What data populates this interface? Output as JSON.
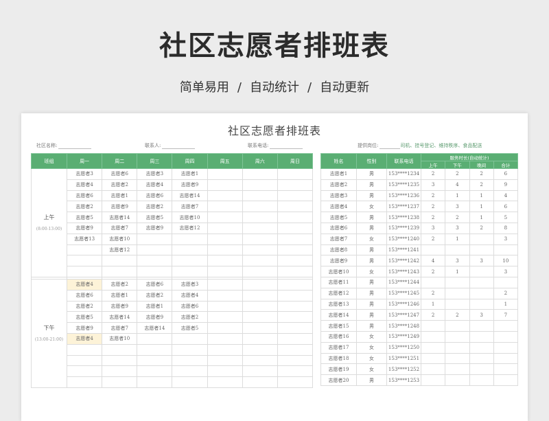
{
  "banner": {
    "title": "社区志愿者排班表",
    "sub1": "简单易用",
    "sub2": "自动统计",
    "sub3": "自动更新",
    "sep": "/"
  },
  "sheet": {
    "title": "社区志愿者排班表",
    "info": {
      "community_label": "社区名称:",
      "contact_label": "联系人:",
      "phone_label": "联系电话:",
      "post_label": "提供岗位:",
      "post_value": "司机、挂号登记、维持秩序、食品配送"
    },
    "schedule": {
      "headers": [
        "班组",
        "周一",
        "周二",
        "周三",
        "周四",
        "周五",
        "周六",
        "周日"
      ],
      "am_label": "上午",
      "am_hours": "(8:00-13:00)",
      "pm_label": "下午",
      "pm_hours": "(13:00-21:00)",
      "am_rows": [
        [
          "志愿者3",
          "志愿者6",
          "志愿者3",
          "志愿者1",
          "",
          "",
          ""
        ],
        [
          "志愿者4",
          "志愿者2",
          "志愿者4",
          "志愿者9",
          "",
          "",
          ""
        ],
        [
          "志愿者6",
          "志愿者1",
          "志愿者6",
          "志愿者14",
          "",
          "",
          ""
        ],
        [
          "志愿者2",
          "志愿者9",
          "志愿者2",
          "志愿者7",
          "",
          "",
          ""
        ],
        [
          "志愿者5",
          "志愿者14",
          "志愿者5",
          "志愿者10",
          "",
          "",
          ""
        ],
        [
          "志愿者9",
          "志愿者7",
          "志愿者9",
          "志愿者12",
          "",
          "",
          ""
        ],
        [
          "志愿者13",
          "志愿者10",
          "",
          "",
          "",
          "",
          ""
        ],
        [
          "",
          "志愿者12",
          "",
          "",
          "",
          "",
          ""
        ],
        [
          "",
          "",
          "",
          "",
          "",
          "",
          ""
        ],
        [
          "",
          "",
          "",
          "",
          "",
          "",
          ""
        ]
      ],
      "pm_rows": [
        [
          "志愿者4",
          "志愿者2",
          "志愿者6",
          "志愿者3",
          "",
          "",
          ""
        ],
        [
          "志愿者6",
          "志愿者1",
          "志愿者2",
          "志愿者4",
          "",
          "",
          ""
        ],
        [
          "志愿者2",
          "志愿者9",
          "志愿者1",
          "志愿者6",
          "",
          "",
          ""
        ],
        [
          "志愿者5",
          "志愿者14",
          "志愿者9",
          "志愿者2",
          "",
          "",
          ""
        ],
        [
          "志愿者9",
          "志愿者7",
          "志愿者14",
          "志愿者5",
          "",
          "",
          ""
        ],
        [
          "志愿者4",
          "志愿者10",
          "",
          "",
          "",
          "",
          ""
        ],
        [
          "",
          "",
          "",
          "",
          "",
          "",
          ""
        ],
        [
          "",
          "",
          "",
          "",
          "",
          "",
          ""
        ],
        [
          "",
          "",
          "",
          "",
          "",
          "",
          ""
        ],
        [
          "",
          "",
          "",
          "",
          "",
          "",
          ""
        ]
      ],
      "pm_highlight": [
        [
          0,
          0
        ],
        [
          5,
          0
        ]
      ]
    },
    "roster": {
      "headers": [
        "姓名",
        "性别",
        "联系电话",
        "服务时长(自动统计)"
      ],
      "subheaders": [
        "上午",
        "下午",
        "晚间",
        "合计"
      ],
      "rows": [
        [
          "志愿者1",
          "男",
          "153****1234",
          "2",
          "2",
          "2",
          "6"
        ],
        [
          "志愿者2",
          "男",
          "153****1235",
          "3",
          "4",
          "2",
          "9"
        ],
        [
          "志愿者3",
          "男",
          "153****1236",
          "2",
          "1",
          "1",
          "4"
        ],
        [
          "志愿者4",
          "女",
          "153****1237",
          "2",
          "3",
          "1",
          "6"
        ],
        [
          "志愿者5",
          "男",
          "153****1238",
          "2",
          "2",
          "1",
          "5"
        ],
        [
          "志愿者6",
          "男",
          "153****1239",
          "3",
          "3",
          "2",
          "8"
        ],
        [
          "志愿者7",
          "女",
          "153****1240",
          "2",
          "1",
          "",
          "3"
        ],
        [
          "志愿者8",
          "男",
          "153****1241",
          "",
          "",
          "",
          ""
        ],
        [
          "志愿者9",
          "男",
          "153****1242",
          "4",
          "3",
          "3",
          "10"
        ],
        [
          "志愿者10",
          "女",
          "153****1243",
          "2",
          "1",
          "",
          "3"
        ],
        [
          "志愿者11",
          "男",
          "153****1244",
          "",
          "",
          "",
          ""
        ],
        [
          "志愿者12",
          "男",
          "153****1245",
          "2",
          "",
          "",
          "2"
        ],
        [
          "志愿者13",
          "男",
          "153****1246",
          "1",
          "",
          "",
          "1"
        ],
        [
          "志愿者14",
          "男",
          "153****1247",
          "2",
          "2",
          "3",
          "7"
        ],
        [
          "志愿者15",
          "男",
          "153****1248",
          "",
          "",
          "",
          ""
        ],
        [
          "志愿者16",
          "女",
          "153****1249",
          "",
          "",
          "",
          ""
        ],
        [
          "志愿者17",
          "女",
          "153****1250",
          "",
          "",
          "",
          ""
        ],
        [
          "志愿者18",
          "女",
          "153****1251",
          "",
          "",
          "",
          ""
        ],
        [
          "志愿者19",
          "女",
          "153****1252",
          "",
          "",
          "",
          ""
        ],
        [
          "志愿者20",
          "男",
          "153****1253",
          "",
          "",
          "",
          ""
        ]
      ]
    },
    "colors": {
      "header_green": "#5aae73",
      "highlight": "#fdf3d8"
    }
  }
}
